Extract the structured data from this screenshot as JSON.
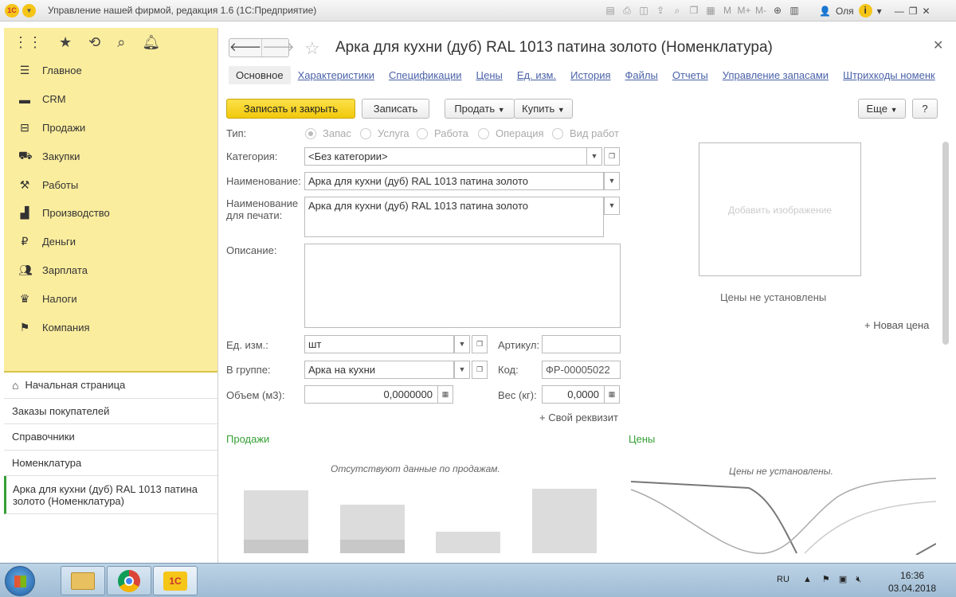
{
  "window": {
    "title": "Управление нашей фирмой, редакция 1.6  (1С:Предприятие)",
    "logo": "1С",
    "user": "Оля",
    "icons": [
      "save-icon",
      "print-icon",
      "preview-icon",
      "upload-icon",
      "find-icon",
      "copy-icon",
      "calendar-icon",
      "memory-m-icon",
      "memory-plus-icon",
      "memory-minus-icon",
      "zoom-icon",
      "window-icon"
    ]
  },
  "memory_labels": {
    "m": "M",
    "mplus": "M+",
    "mminus": "M-"
  },
  "sidebar": {
    "sections": [
      {
        "label": "Главное",
        "icon": "menu-icon"
      },
      {
        "label": "CRM",
        "icon": "crm-icon"
      },
      {
        "label": "Продажи",
        "icon": "basket-icon"
      },
      {
        "label": "Закупки",
        "icon": "truck-icon"
      },
      {
        "label": "Работы",
        "icon": "tools-icon"
      },
      {
        "label": "Производство",
        "icon": "factory-icon"
      },
      {
        "label": "Деньги",
        "icon": "ruble-icon"
      },
      {
        "label": "Зарплата",
        "icon": "people-icon"
      },
      {
        "label": "Налоги",
        "icon": "eagle-icon"
      },
      {
        "label": "Компания",
        "icon": "flag-icon"
      }
    ],
    "nav": [
      {
        "label": "Начальная страница"
      },
      {
        "label": "Заказы покупателей"
      },
      {
        "label": "Справочники"
      },
      {
        "label": "Номенклатура"
      },
      {
        "label": "Арка для кухни (дуб) RAL 1013 патина золото (Номенклатура)"
      }
    ]
  },
  "form": {
    "title": "Арка для кухни (дуб) RAL 1013 патина золото (Номенклатура)",
    "tabs": [
      "Основное",
      "Характеристики",
      "Спецификации",
      "Цены",
      "Ед. изм.",
      "История",
      "Файлы",
      "Отчеты",
      "Управление запасами",
      "Штрихкоды номенк"
    ],
    "buttons": {
      "save_close": "Записать и закрыть",
      "save": "Записать",
      "sell": "Продать",
      "buy": "Купить",
      "more": "Еще",
      "help": "?"
    },
    "type": {
      "label": "Тип:",
      "options": [
        "Запас",
        "Услуга",
        "Работа",
        "Операция",
        "Вид работ"
      ],
      "selected": "Запас"
    },
    "category": {
      "label": "Категория:",
      "value": "<Без категории>"
    },
    "name": {
      "label": "Наименование:",
      "value": "Арка для кухни (дуб) RAL 1013 патина золото"
    },
    "print_name": {
      "label1": "Наименование",
      "label2": "для печати:",
      "value": "Арка для кухни (дуб) RAL 1013 патина золото"
    },
    "description": {
      "label": "Описание:",
      "value": ""
    },
    "unit": {
      "label": "Ед. изм.:",
      "value": "шт"
    },
    "article": {
      "label": "Артикул:",
      "value": ""
    },
    "group": {
      "label": "В группе:",
      "value": "Арка на кухни"
    },
    "code": {
      "label": "Код:",
      "value": "ФР-00005022"
    },
    "volume": {
      "label": "Объем (м3):",
      "value": "0,0000000"
    },
    "weight": {
      "label": "Вес (кг):",
      "value": "0,0000"
    },
    "add_attribute": "+ Свой реквизит",
    "image_placeholder": "Добавить изображение",
    "prices_not_set": "Цены не установлены",
    "new_price": "+ Новая цена",
    "sales_header": "Продажи",
    "sales_empty": "Отсутствуют данные по продажам.",
    "prices_header": "Цены",
    "prices_empty": "Цены не установлены."
  },
  "taskbar": {
    "lang": "RU",
    "time": "16:36",
    "date": "03.04.2018"
  }
}
